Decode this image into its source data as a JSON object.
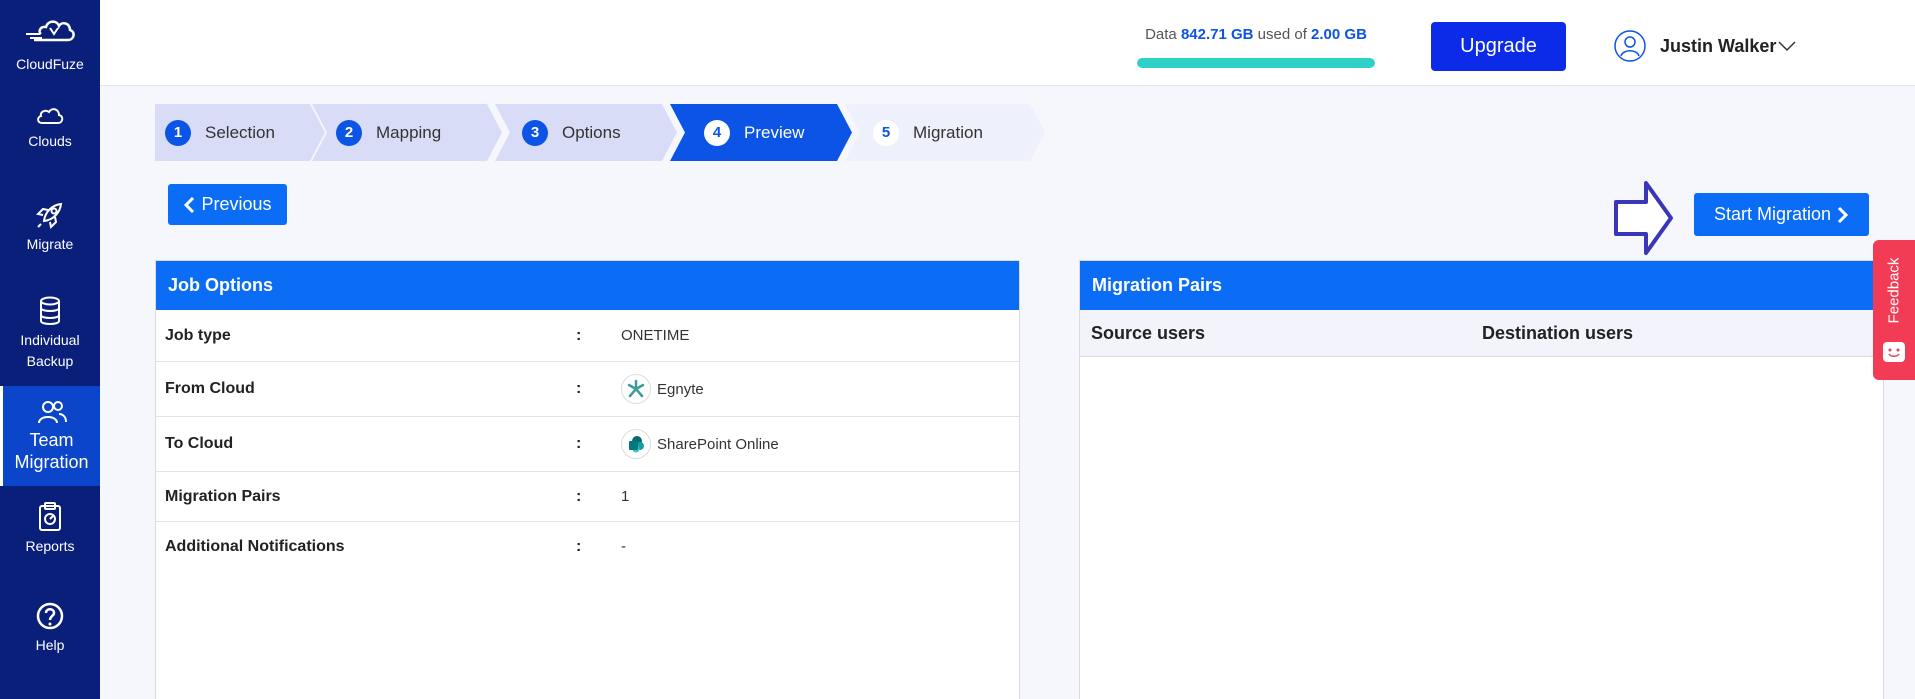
{
  "brand": {
    "name": "CloudFuze"
  },
  "sidebar": {
    "items": [
      {
        "label": "Clouds",
        "icon": "cloud-icon"
      },
      {
        "label": "Migrate",
        "icon": "rocket-icon"
      },
      {
        "label_line1": "Individual",
        "label_line2": "Backup",
        "icon": "database-icon"
      },
      {
        "label_line1": "Team",
        "label_line2": "Migration",
        "icon": "team-icon"
      },
      {
        "label": "Reports",
        "icon": "clipboard-icon"
      },
      {
        "label": "Help",
        "icon": "help-icon"
      }
    ]
  },
  "header": {
    "usage_prefix": "Data",
    "usage_used": "842.71 GB",
    "usage_mid": "used of",
    "usage_total": "2.00 GB",
    "usage_fill_fraction": 1.0,
    "upgrade_label": "Upgrade",
    "user_name": "Justin Walker"
  },
  "stepper": {
    "steps": [
      {
        "num": "1",
        "label": "Selection",
        "state": "done"
      },
      {
        "num": "2",
        "label": "Mapping",
        "state": "done"
      },
      {
        "num": "3",
        "label": "Options",
        "state": "done"
      },
      {
        "num": "4",
        "label": "Preview",
        "state": "active"
      },
      {
        "num": "5",
        "label": "Migration",
        "state": "pending"
      }
    ]
  },
  "actions": {
    "previous_label": "Previous",
    "start_label": "Start Migration"
  },
  "job_options": {
    "title": "Job Options",
    "separator": ":",
    "rows": [
      {
        "key": "Job type",
        "value": "ONETIME"
      },
      {
        "key": "From Cloud",
        "value": "Egnyte",
        "icon": "egnyte-logo-icon"
      },
      {
        "key": "To Cloud",
        "value": "SharePoint Online",
        "icon": "sharepoint-logo-icon"
      },
      {
        "key": "Migration Pairs",
        "value": "1"
      },
      {
        "key": "Additional Notifications",
        "value": "-"
      }
    ]
  },
  "migration_pairs": {
    "title": "Migration Pairs",
    "col_source": "Source users",
    "col_destination": "Destination users"
  },
  "feedback": {
    "label": "Feedback"
  },
  "colors": {
    "sidebar": "#0a1f7a",
    "primary": "#0b6cf5",
    "upgrade": "#0c2be8",
    "usage_bar": "#2fd1c6",
    "feedback": "#f23b54"
  }
}
